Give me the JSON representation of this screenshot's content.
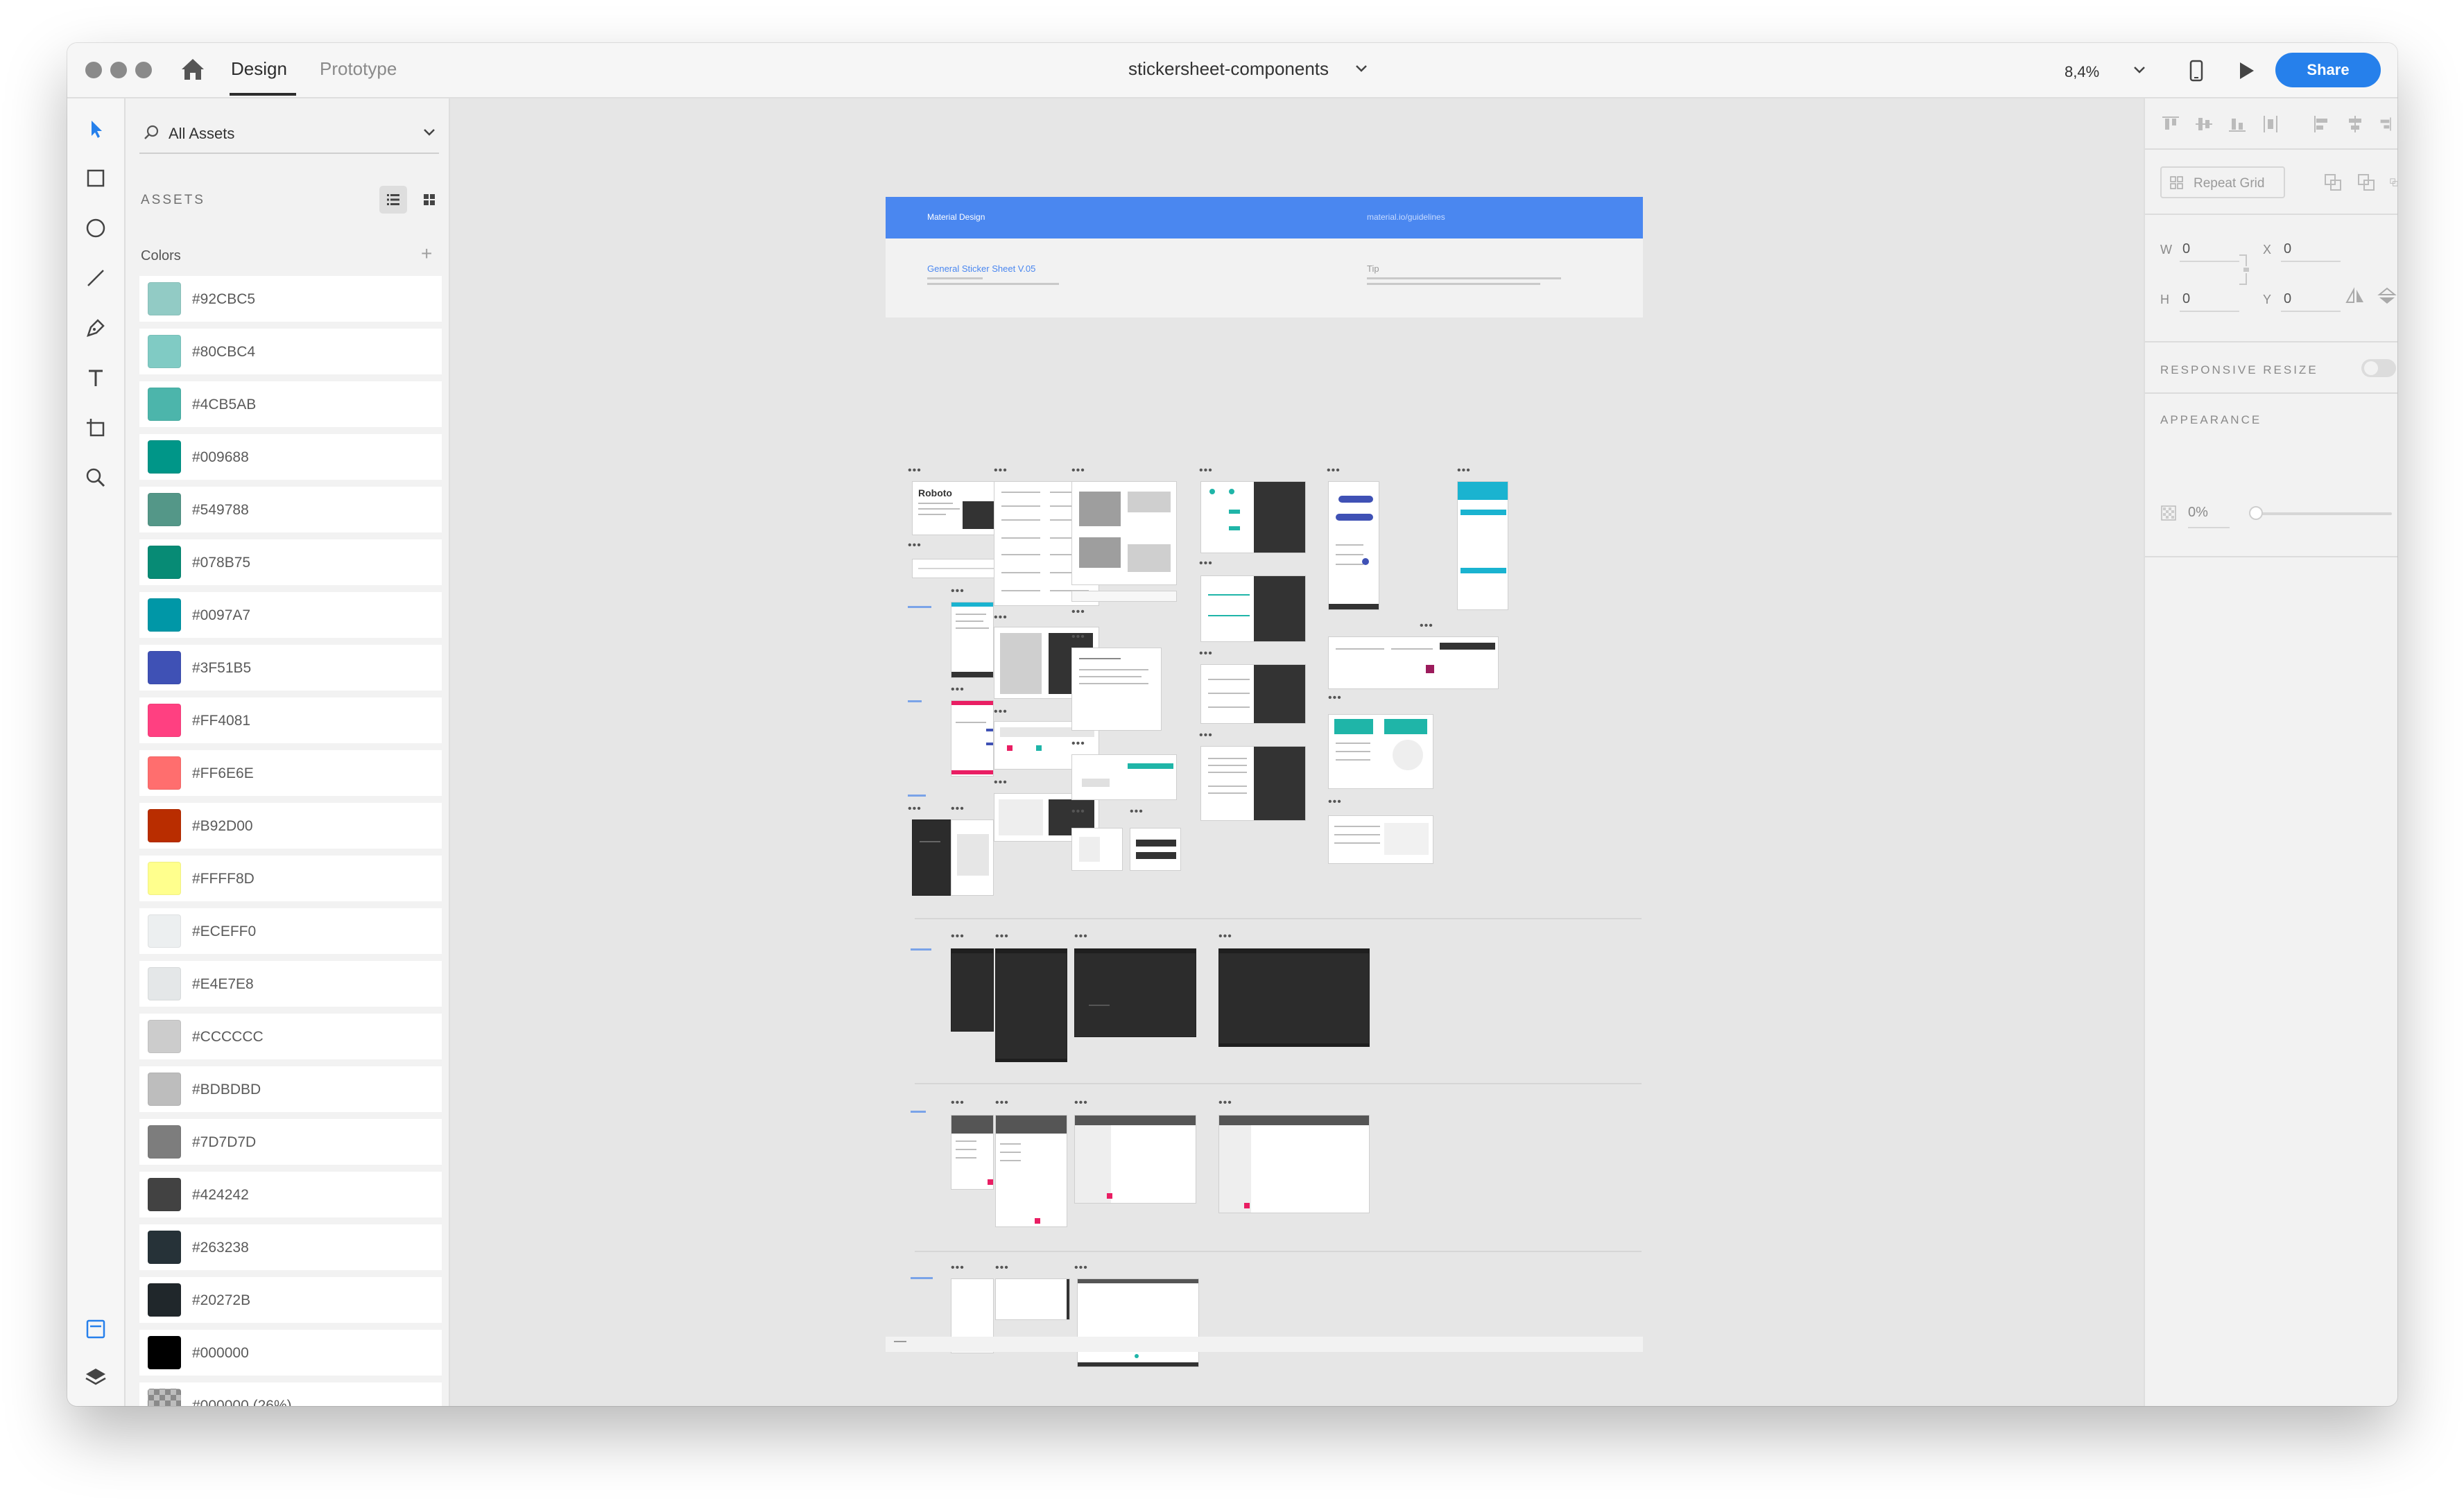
{
  "window": {
    "tabs": [
      {
        "label": "Design",
        "active": true
      },
      {
        "label": "Prototype",
        "active": false
      }
    ],
    "document_title": "stickersheet-components",
    "zoom": "8,4%",
    "share_label": "Share"
  },
  "tools": [
    "select-tool-icon",
    "rectangle-tool-icon",
    "ellipse-tool-icon",
    "line-tool-icon",
    "pen-tool-icon",
    "text-tool-icon",
    "artboard-tool-icon",
    "zoom-tool-icon"
  ],
  "assets": {
    "search_value": "All Assets",
    "heading": "ASSETS",
    "colors_heading": "Colors",
    "colors": [
      {
        "label": "#92CBC5",
        "hex": "#92CBC5"
      },
      {
        "label": "#80CBC4",
        "hex": "#80CBC4"
      },
      {
        "label": "#4CB5AB",
        "hex": "#4CB5AB"
      },
      {
        "label": "#009688",
        "hex": "#009688"
      },
      {
        "label": "#549788",
        "hex": "#549788"
      },
      {
        "label": "#078B75",
        "hex": "#078B75"
      },
      {
        "label": "#0097A7",
        "hex": "#0097A7"
      },
      {
        "label": "#3F51B5",
        "hex": "#3F51B5"
      },
      {
        "label": "#FF4081",
        "hex": "#FF4081"
      },
      {
        "label": "#FF6E6E",
        "hex": "#FF6E6E"
      },
      {
        "label": "#B92D00",
        "hex": "#B92D00"
      },
      {
        "label": "#FFFF8D",
        "hex": "#FFFF8D"
      },
      {
        "label": "#ECEFF0",
        "hex": "#ECEFF0"
      },
      {
        "label": "#E4E7E8",
        "hex": "#E4E7E8"
      },
      {
        "label": "#CCCCCC",
        "hex": "#CCCCCC"
      },
      {
        "label": "#BDBDBD",
        "hex": "#BDBDBD"
      },
      {
        "label": "#7D7D7D",
        "hex": "#7D7D7D"
      },
      {
        "label": "#424242",
        "hex": "#424242"
      },
      {
        "label": "#263238",
        "hex": "#263238"
      },
      {
        "label": "#20272B",
        "hex": "#20272B"
      },
      {
        "label": "#000000",
        "hex": "#000000"
      },
      {
        "label": "#000000 (26%)",
        "hex": "checker"
      }
    ]
  },
  "canvas": {
    "header_left": "Material Design",
    "header_right": "material.io/guidelines",
    "intro_title": "General Sticker Sheet V.05",
    "intro_tip": "Tip",
    "roboto_label": "Roboto"
  },
  "inspector": {
    "repeat_grid_label": "Repeat Grid",
    "w_label": "W",
    "w_value": "0",
    "x_label": "X",
    "x_value": "0",
    "h_label": "H",
    "h_value": "0",
    "y_label": "Y",
    "y_value": "0",
    "responsive_resize": "RESPONSIVE RESIZE",
    "responsive_resize_on": false,
    "appearance": "APPEARANCE",
    "opacity_value": "0%",
    "opacity_fraction": 0
  },
  "accent_color": "#2680EB"
}
